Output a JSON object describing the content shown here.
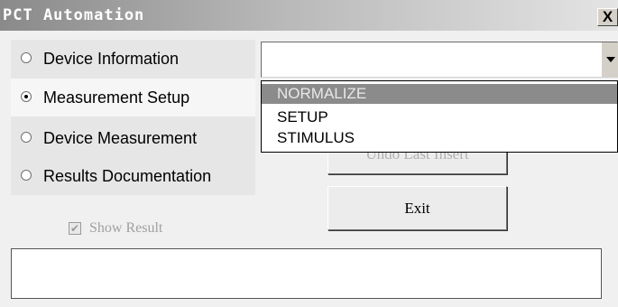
{
  "window": {
    "title": "PCT Automation",
    "close_label": "X"
  },
  "radios": [
    {
      "label": "Device Information",
      "selected": false
    },
    {
      "label": "Measurement Setup",
      "selected": true
    },
    {
      "label": "Device Measurement",
      "selected": false
    },
    {
      "label": "Results Documentation",
      "selected": false
    }
  ],
  "combo": {
    "value": "",
    "options": [
      "NORMALIZE",
      "SETUP",
      "STIMULUS"
    ],
    "highlighted_option": "NORMALIZE"
  },
  "buttons": {
    "undo_label": "Undo Last Insert",
    "exit_label": "Exit"
  },
  "show_result": {
    "label": "Show Result",
    "checked": true,
    "enabled": false
  },
  "result_text": ""
}
